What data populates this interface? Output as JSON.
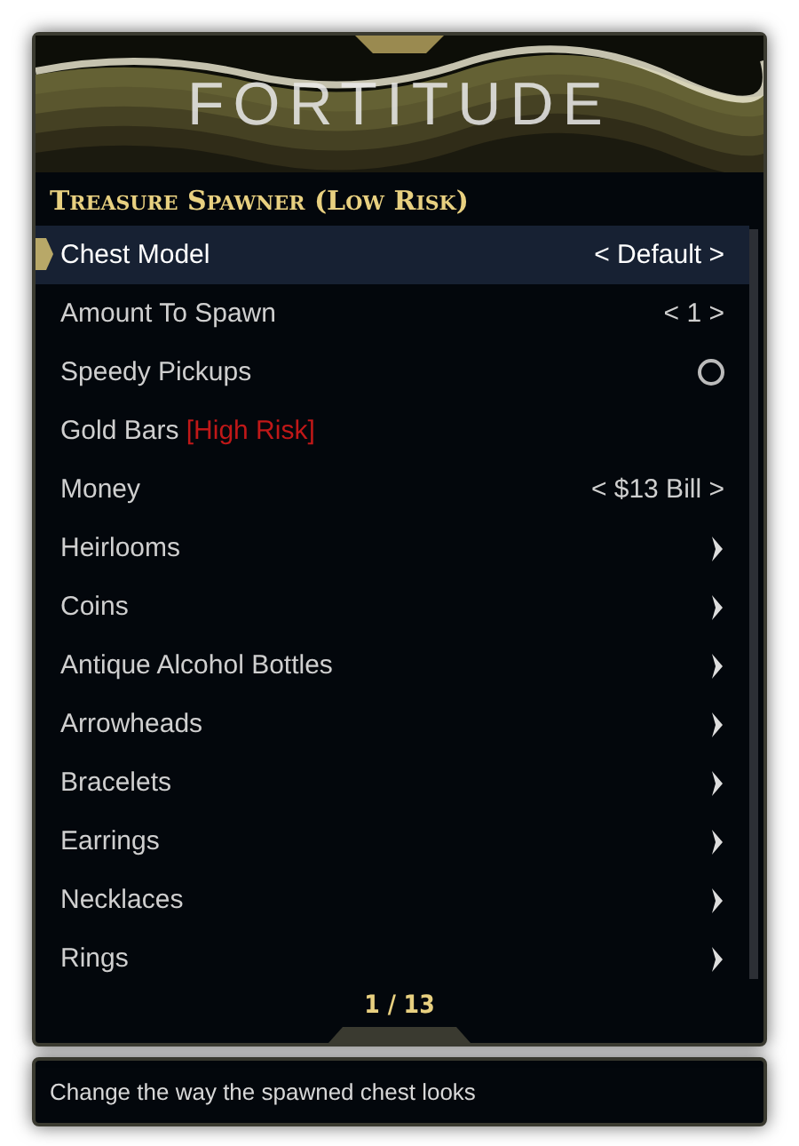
{
  "header": {
    "title": "FORTITUDE",
    "subtitle": "Treasure Spawner (Low Risk)"
  },
  "items": [
    {
      "kind": "value",
      "label": "Chest Model",
      "value": "< Default >",
      "selected": true
    },
    {
      "kind": "value",
      "label": "Amount To Spawn",
      "value": "< 1 >",
      "selected": false
    },
    {
      "kind": "toggle",
      "label": "Speedy Pickups",
      "on": false,
      "selected": false
    },
    {
      "kind": "action",
      "label": "Gold Bars",
      "tag": "[High Risk]",
      "selected": false
    },
    {
      "kind": "value",
      "label": "Money",
      "value": "< $13 Bill >",
      "selected": false
    },
    {
      "kind": "submenu",
      "label": "Heirlooms",
      "selected": false
    },
    {
      "kind": "submenu",
      "label": "Coins",
      "selected": false
    },
    {
      "kind": "submenu",
      "label": "Antique Alcohol Bottles",
      "selected": false
    },
    {
      "kind": "submenu",
      "label": "Arrowheads",
      "selected": false
    },
    {
      "kind": "submenu",
      "label": "Bracelets",
      "selected": false
    },
    {
      "kind": "submenu",
      "label": "Earrings",
      "selected": false
    },
    {
      "kind": "submenu",
      "label": "Necklaces",
      "selected": false
    },
    {
      "kind": "submenu",
      "label": "Rings",
      "selected": false
    }
  ],
  "page": "1 / 13",
  "description": "Change the way the spawned chest looks"
}
